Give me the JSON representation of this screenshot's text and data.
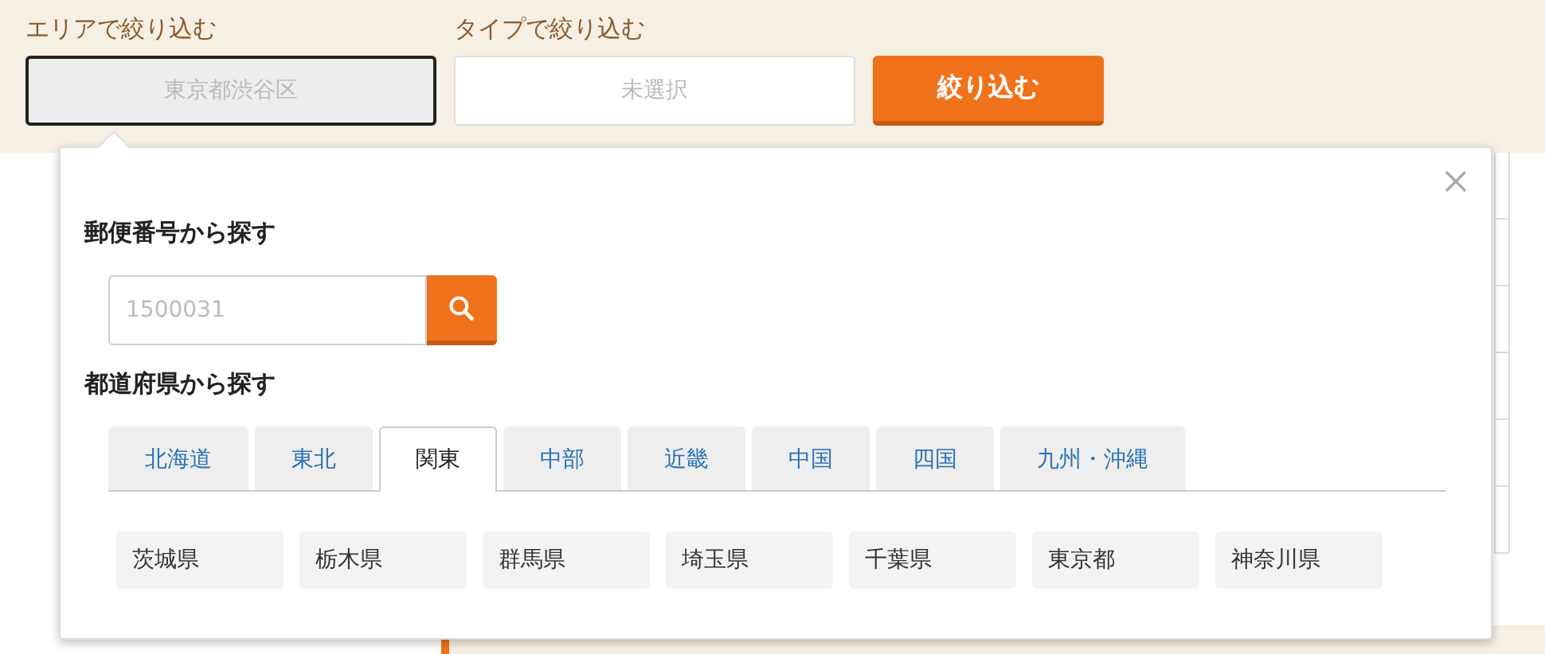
{
  "filters": [
    {
      "label": "エリアで絞り込む",
      "value": "東京都渋谷区",
      "active": true
    },
    {
      "label": "タイプで絞り込む",
      "value": "未選択",
      "active": false
    }
  ],
  "submit_button": "絞り込む",
  "area_popup": {
    "postal_heading": "郵便番号から探す",
    "postal_placeholder": "1500031",
    "prefecture_heading": "都道府県から探す",
    "regions": [
      {
        "label": "北海道",
        "selected": false
      },
      {
        "label": "東北",
        "selected": false
      },
      {
        "label": "関東",
        "selected": true
      },
      {
        "label": "中部",
        "selected": false
      },
      {
        "label": "近畿",
        "selected": false
      },
      {
        "label": "中国",
        "selected": false
      },
      {
        "label": "四国",
        "selected": false
      },
      {
        "label": "九州・沖縄",
        "selected": false
      }
    ],
    "prefectures": [
      "茨城県",
      "栃木県",
      "群馬県",
      "埼玉県",
      "千葉県",
      "東京都",
      "神奈川県"
    ]
  }
}
